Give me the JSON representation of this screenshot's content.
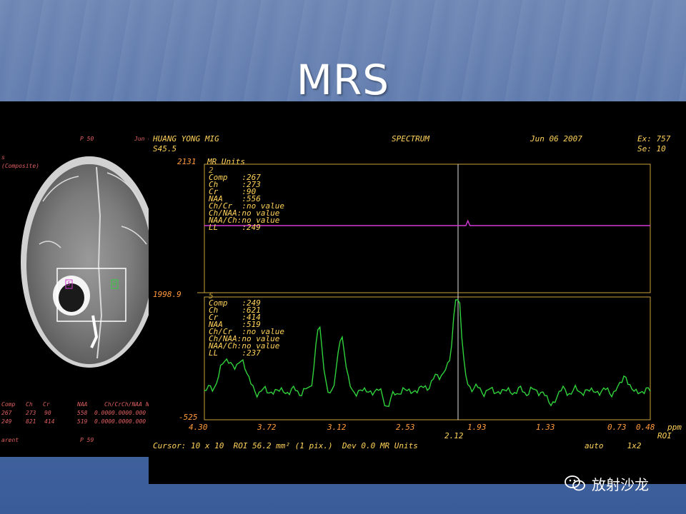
{
  "slide": {
    "title": "MRS"
  },
  "mri_panel": {
    "header_left": "P 50",
    "header_right": "Jun 0",
    "label_top": "s",
    "label_sub": "(Composite)",
    "voxel_labels": [
      "5",
      "6"
    ],
    "table_headers": [
      "Comp",
      "Ch",
      "Cr",
      "NAA",
      "Ch/Cr",
      "Ch/NAA",
      "N"
    ],
    "table_rows": [
      [
        "267",
        "273",
        "90",
        "558",
        "0.000",
        "0.000",
        "0.000"
      ],
      [
        "249",
        "821",
        "414",
        "519",
        "0.000",
        "0.000",
        "0.000"
      ]
    ],
    "footer_left": "arent",
    "footer_right": "P 59"
  },
  "spectrum": {
    "header": {
      "patient": "HUANG YONG MIG",
      "series": "S45.5",
      "title": "SPECTRUM",
      "date": "Jun 06 2007",
      "exam": "Ex: 757",
      "se": "Se: 10"
    },
    "y_unit_label": "MR Units",
    "y_top": "2131",
    "y_mid": "1998.9",
    "y_bottom": "-525",
    "panel1": {
      "index": "2",
      "lines": [
        "Comp   :267",
        "Ch     :273",
        "Cr     :90",
        "NAA    :556",
        "Ch/Cr  :no value",
        "Ch/NAA:no value",
        "NAA/Ch:no value",
        "LL     :249"
      ]
    },
    "panel2": {
      "index": "5",
      "lines": [
        "Comp   :249",
        "Ch     :621",
        "Cr     :414",
        "NAA    :519",
        "Ch/Cr  :no value",
        "Ch/NAA:no value",
        "NAA/Ch:no value",
        "LL     :237"
      ]
    },
    "x_ticks": [
      "4.30",
      "3.72",
      "3.12",
      "2.53",
      "1.93",
      "1.33",
      "0.73"
    ],
    "x_right": "0.48",
    "x_unit": "ppm",
    "cursor_ppm": "2.12",
    "roi_right": "ROI",
    "footer": "Cursor: 10 x 10  ROI 56.2 mm² (1 pix.)  Dev 0.0 MR Units",
    "footer_right": "auto     1x2",
    "colors": {
      "trace1": "#d23ad2",
      "trace2": "#2fd23a",
      "axes": "#c9a23a",
      "text": "#ffd25a"
    }
  },
  "watermark": {
    "label": "放射沙龙",
    "icon": "wechat-icon"
  }
}
